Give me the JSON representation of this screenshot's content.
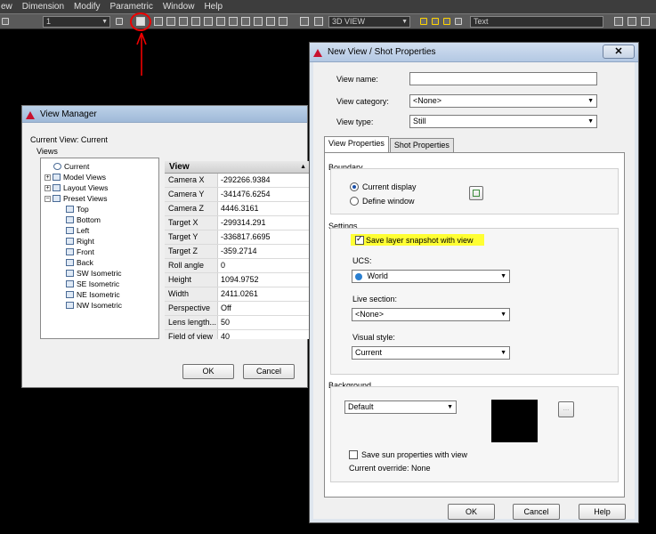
{
  "menubar": {
    "items": [
      "ew",
      "Dimension",
      "Modify",
      "Parametric",
      "Window",
      "Help"
    ]
  },
  "toolbar": {
    "layer_value": "1",
    "view_value": "3D VIEW",
    "text_value": "Text"
  },
  "view_manager": {
    "title": "View Manager",
    "current_view": "Current View: Current",
    "views_label": "Views",
    "tree": {
      "current": "Current",
      "model_views": "Model Views",
      "layout_views": "Layout Views",
      "preset_views": "Preset Views",
      "presets": [
        "Top",
        "Bottom",
        "Left",
        "Right",
        "Front",
        "Back",
        "SW Isometric",
        "SE Isometric",
        "NE Isometric",
        "NW Isometric"
      ]
    },
    "props_header": "View",
    "props": [
      {
        "k": "Camera X",
        "v": "-292266.9384"
      },
      {
        "k": "Camera Y",
        "v": "-341476.6254"
      },
      {
        "k": "Camera Z",
        "v": "4446.3161"
      },
      {
        "k": "Target X",
        "v": "-299314.291"
      },
      {
        "k": "Target Y",
        "v": "-336817.6695"
      },
      {
        "k": "Target Z",
        "v": "-359.2714"
      },
      {
        "k": "Roll angle",
        "v": "0"
      },
      {
        "k": "Height",
        "v": "1094.9752"
      },
      {
        "k": "Width",
        "v": "2411.0261"
      },
      {
        "k": "Perspective",
        "v": "Off"
      },
      {
        "k": "Lens length...",
        "v": "50"
      },
      {
        "k": "Field of view",
        "v": "40"
      }
    ],
    "ok": "OK",
    "cancel": "Cancel"
  },
  "new_view": {
    "title": "New View / Shot Properties",
    "close": "✕",
    "view_name_label": "View name:",
    "view_name_value": "",
    "view_category_label": "View category:",
    "view_category_value": "<None>",
    "view_type_label": "View type:",
    "view_type_value": "Still",
    "tab_view_properties": "View Properties",
    "tab_shot_properties": "Shot Properties",
    "boundary_label": "Boundary",
    "current_display": "Current display",
    "define_window": "Define window",
    "settings_label": "Settings",
    "save_layer_snapshot": "Save layer snapshot with view",
    "ucs_label": "UCS:",
    "ucs_value": "World",
    "live_section_label": "Live section:",
    "live_section_value": "<None>",
    "visual_style_label": "Visual style:",
    "visual_style_value": "Current",
    "background_label": "Background",
    "background_value": "Default",
    "more_button": "...",
    "save_sun_label": "Save sun properties with view",
    "current_override": "Current override: None",
    "ok": "OK",
    "cancel": "Cancel",
    "help": "Help"
  },
  "colors": {
    "highlight": "#ffff33",
    "annotation": "#ee0000"
  }
}
